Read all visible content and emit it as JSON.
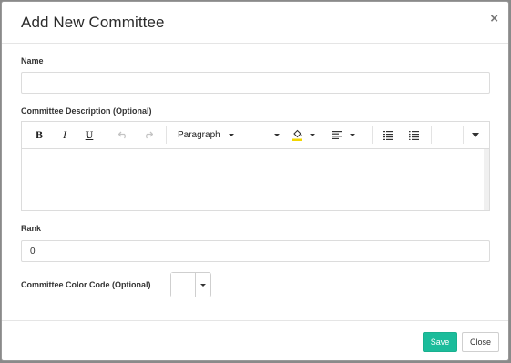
{
  "modal": {
    "title": "Add New Committee",
    "close_symbol": "×"
  },
  "form": {
    "name_label": "Name",
    "name_value": "",
    "description_label": "Committee Description (Optional)",
    "rank_label": "Rank",
    "rank_value": "0",
    "color_label": "Committee Color Code (Optional)"
  },
  "toolbar": {
    "bold": "B",
    "italic": "I",
    "underline": "U",
    "paragraph_style": "Paragraph",
    "highlight_color": "#f2d600"
  },
  "footer": {
    "save_label": "Save",
    "close_label": "Close"
  },
  "colors": {
    "accent": "#1bbc9b"
  }
}
